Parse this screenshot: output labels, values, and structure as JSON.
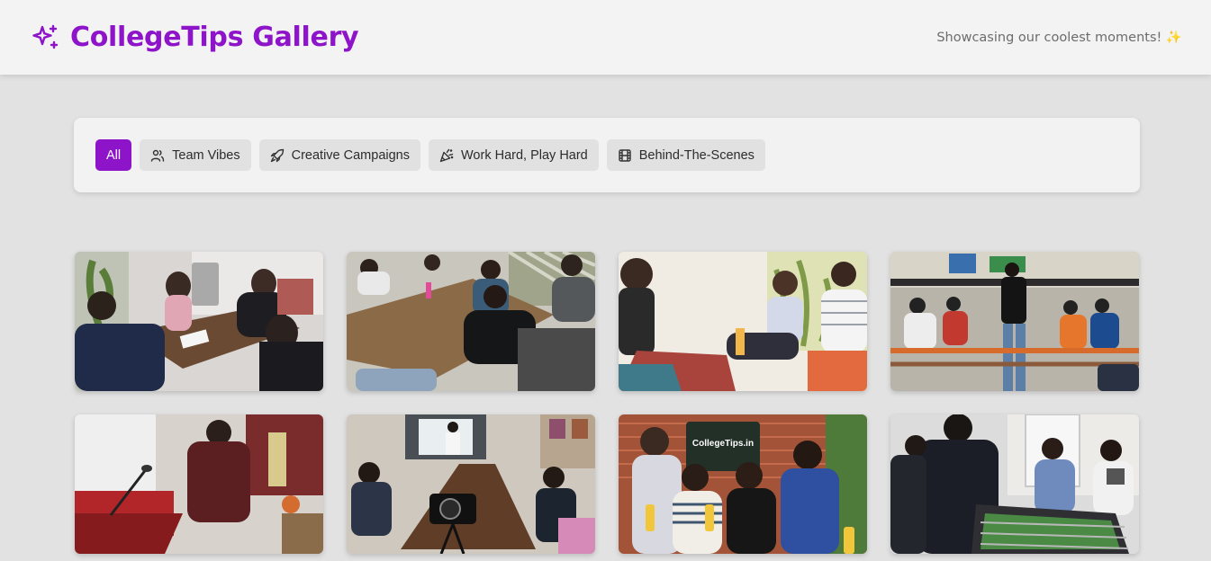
{
  "header": {
    "title": "CollegeTips Gallery",
    "tagline": "Showcasing our coolest moments! ✨",
    "brand_icon": "sparkles-icon",
    "accent_color": "#8e14c9"
  },
  "filters": [
    {
      "label": "All",
      "icon": null,
      "active": true
    },
    {
      "label": "Team Vibes",
      "icon": "users-icon",
      "active": false
    },
    {
      "label": "Creative Campaigns",
      "icon": "rocket-icon",
      "active": false
    },
    {
      "label": "Work Hard, Play Hard",
      "icon": "party-popper-icon",
      "active": false
    },
    {
      "label": "Behind-The-Scenes",
      "icon": "film-icon",
      "active": false
    }
  ],
  "gallery": {
    "photos": [
      {
        "subject": "meeting-table-interview"
      },
      {
        "subject": "conference-room-discussion"
      },
      {
        "subject": "lounge-conversation"
      },
      {
        "subject": "auditorium-event"
      },
      {
        "subject": "speaker-at-podium"
      },
      {
        "subject": "video-shoot-boardroom"
      },
      {
        "subject": "team-group-photo",
        "sign_text": "CollegeTips.in"
      },
      {
        "subject": "foosball-game"
      }
    ]
  }
}
